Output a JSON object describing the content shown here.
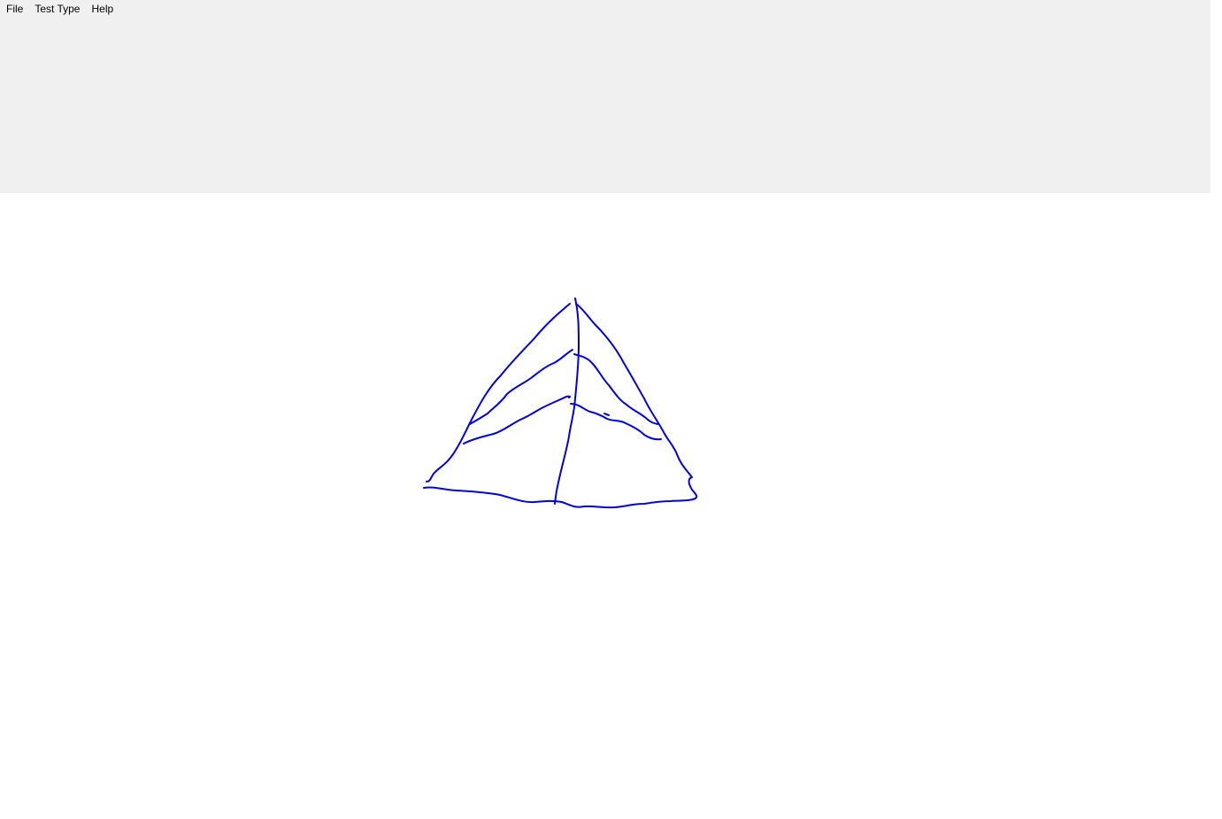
{
  "menu": {
    "items": [
      {
        "label": "File"
      },
      {
        "label": "Test Type"
      },
      {
        "label": "Help"
      }
    ]
  },
  "drawing": {
    "shape": "sketched pyramid",
    "stroke_color": "#0000e0"
  }
}
